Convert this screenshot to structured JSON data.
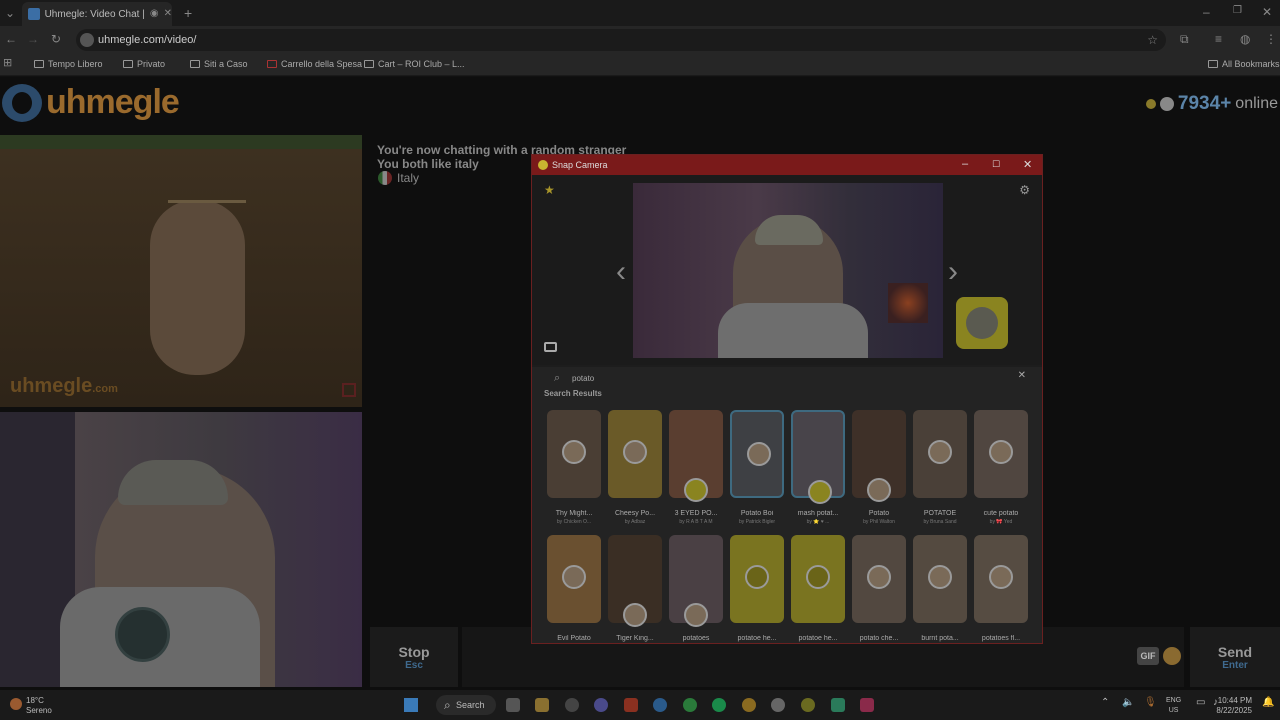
{
  "browser": {
    "tab_title": "Uhmegle: Video Chat | Onl",
    "url": "uhmegle.com/video/",
    "bookmarks": [
      "Tempo Libero",
      "Privato",
      "Siti a Caso",
      "Carrello della Spesa",
      "Cart – ROI Club – L...",
      "All Bookmarks"
    ]
  },
  "site": {
    "logo_text": "uhmegle",
    "online_count": "7934+",
    "online_label": "online",
    "watermark": "uhmegle",
    "watermark_suffix": ".com"
  },
  "chat": {
    "line1": "You're now chatting with a random stranger",
    "line2": "You both like italy",
    "country": "Italy"
  },
  "controls": {
    "stop_label": "Stop",
    "stop_key": "Esc",
    "gif_label": "GIF",
    "send_label": "Send",
    "send_key": "Enter"
  },
  "snap_camera": {
    "title": "Snap Camera",
    "search_value": "potato",
    "results_label": "Search Results",
    "lenses": [
      {
        "name": "Thy Might...",
        "author": "by Chicken Ö..."
      },
      {
        "name": "Cheesy Po...",
        "author": "by Adbaz"
      },
      {
        "name": "3 EYED PO...",
        "author": "by R A B T A M"
      },
      {
        "name": "Potato Boi",
        "author": "by Patrick Bigler"
      },
      {
        "name": "mash potat...",
        "author": "by ⭐ ♥ ..."
      },
      {
        "name": "Potato",
        "author": "by Phil Walton"
      },
      {
        "name": "POTATOE",
        "author": "by Bruna Sand"
      },
      {
        "name": "cute potato",
        "author": "by 🎀 Yed"
      },
      {
        "name": "Evil Potato",
        "author": ""
      },
      {
        "name": "Tiger King...",
        "author": ""
      },
      {
        "name": "potatoes",
        "author": ""
      },
      {
        "name": "potatoe he...",
        "author": ""
      },
      {
        "name": "potatoe he...",
        "author": ""
      },
      {
        "name": "potato che...",
        "author": ""
      },
      {
        "name": "burnt pota...",
        "author": ""
      },
      {
        "name": "potatoes fl...",
        "author": ""
      }
    ]
  },
  "taskbar": {
    "temp": "18°C",
    "condition": "Sereno",
    "search_label": "Search",
    "lang1": "ENG",
    "lang2": "US",
    "time": "10:44 PM",
    "date": "8/22/2025"
  }
}
